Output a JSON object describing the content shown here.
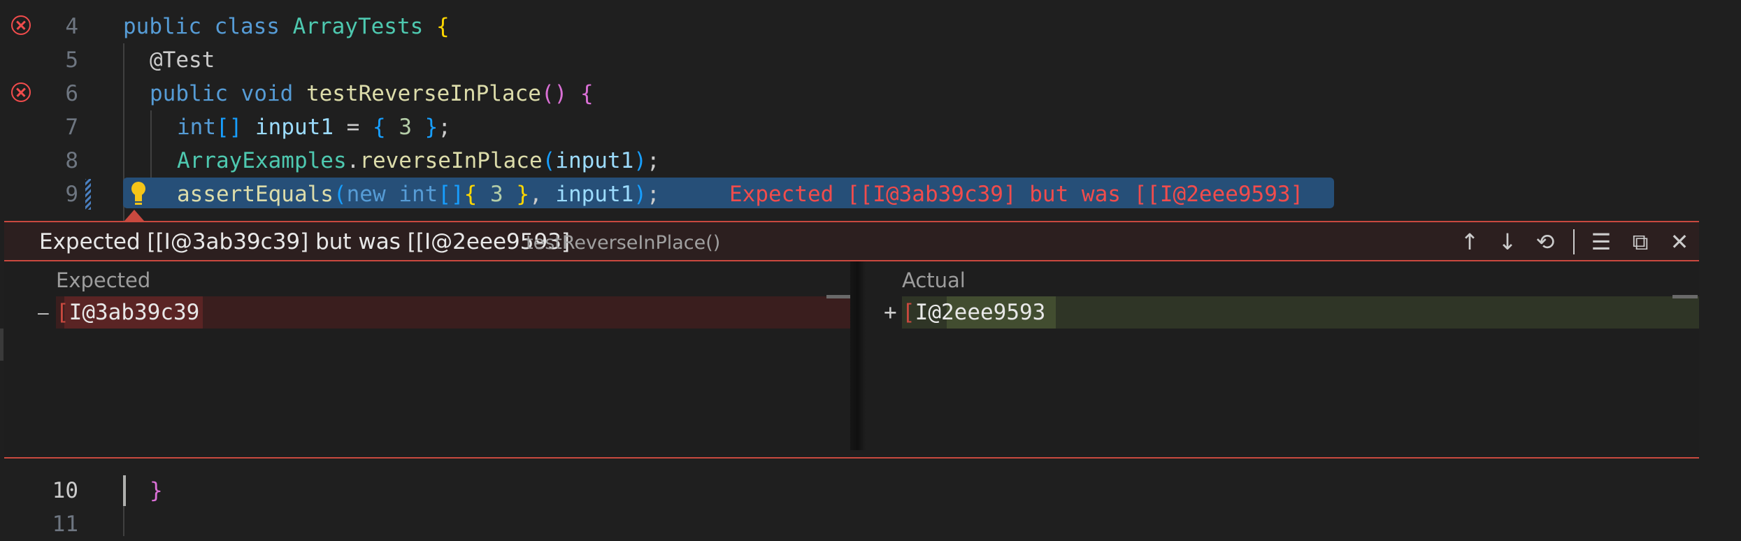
{
  "editor": {
    "line_numbers": [
      "4",
      "5",
      "6",
      "7",
      "8",
      "9",
      "10",
      "11"
    ],
    "line4": {
      "kw1": "public",
      "kw2": "class",
      "cls": "ArrayTests",
      "brace": "{"
    },
    "line5": {
      "annotation": "@Test"
    },
    "line6": {
      "kw1": "public",
      "kw2": "void",
      "fn": "testReverseInPlace",
      "parens": "()",
      "brace": "{"
    },
    "line7": {
      "type": "int",
      "brackets": "[]",
      "var": "input1",
      "eq": " = ",
      "open": "{",
      "num": " 3 ",
      "close": "}",
      "semi": ";"
    },
    "line8": {
      "cls": "ArrayExamples",
      "dot": ".",
      "fn": "reverseInPlace",
      "open": "(",
      "var": "input1",
      "close": ")",
      "semi": ";"
    },
    "line9": {
      "fn": "assertEquals",
      "open": "(",
      "kw": "new",
      "type": "int",
      "brackets": "[]",
      "brace_open": "{",
      "num": " 3 ",
      "brace_close": "}",
      "comma": ", ",
      "var": "input1",
      "close": ")",
      "semi": ";"
    },
    "inline_error": "Expected [[I@3ab39c39] but was [[I@2eee9593]",
    "line10": {
      "brace": "}"
    }
  },
  "peek": {
    "message": "Expected [[I@3ab39c39] but was [[I@2eee9593]",
    "test_name": "testReverseInPlace()",
    "expected_label": "Expected",
    "expected_value": "I@3ab39c39",
    "actual_label": "Actual",
    "actual_value": "I@2eee9593",
    "bracket": "[",
    "minus_marker": "—",
    "plus_marker": "+",
    "toolbar": {
      "up": "↑",
      "down": "↓",
      "history": "⟲",
      "clear": "☰",
      "open": "⧉",
      "close": "✕"
    }
  },
  "colors": {
    "error": "#f14c4c",
    "selection": "#264f78",
    "removed": "#4b1818",
    "added": "#373d29"
  },
  "icons": {
    "error": "error-icon",
    "lightbulb": "lightbulb-icon"
  }
}
